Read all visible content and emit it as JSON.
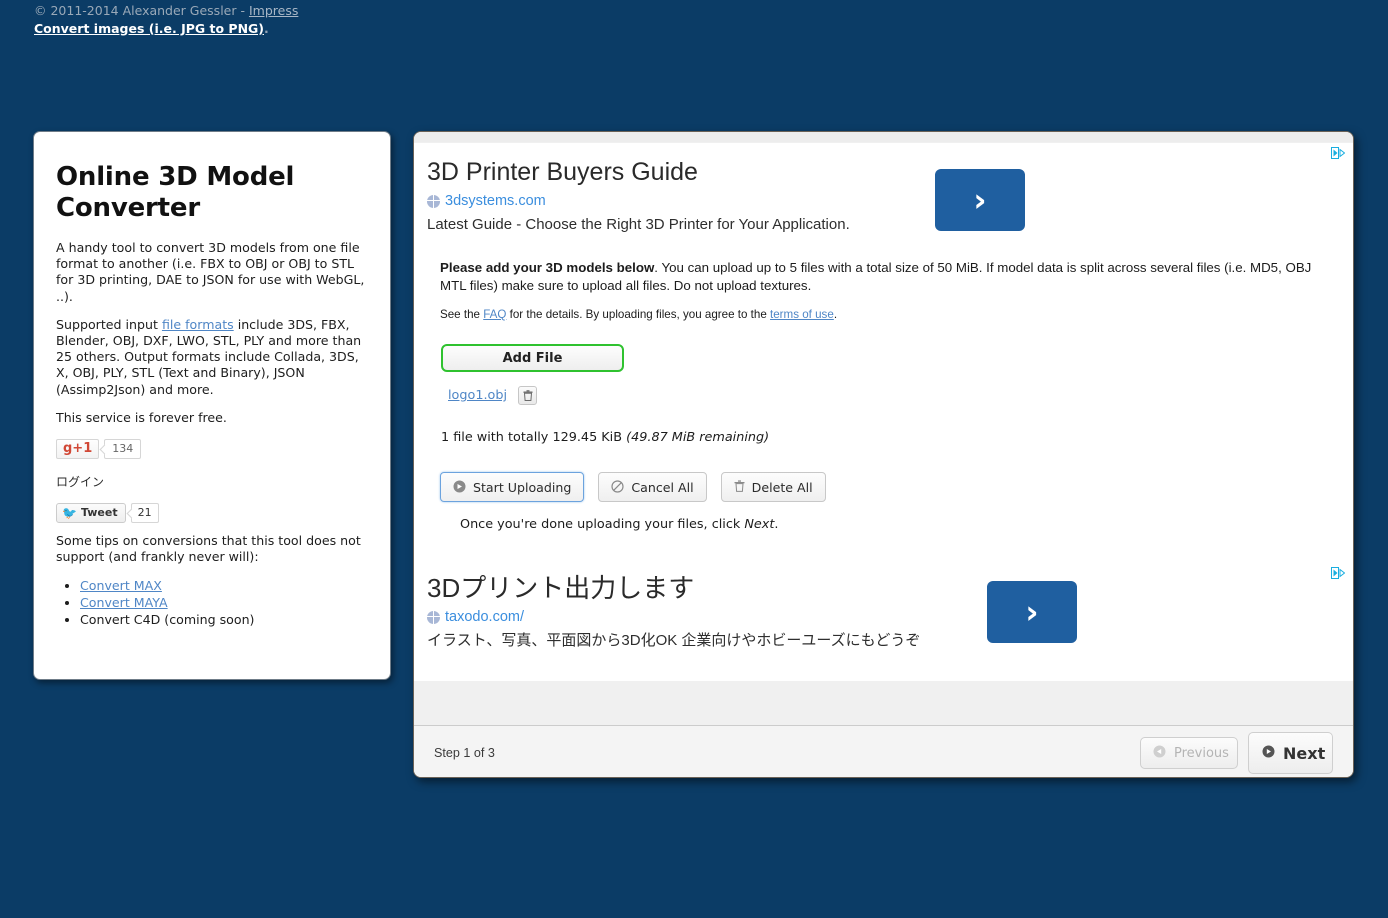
{
  "topbar": {
    "copyright": "© 2011-2014 Alexander Gessler - ",
    "impress_label": "Impress",
    "convert_link_label": "Convert images (i.e. JPG to PNG)",
    "convert_suffix": "."
  },
  "sidebar": {
    "title": "Online 3D Model Converter",
    "intro": "A handy tool to convert 3D models from one file format to another (i.e. FBX to OBJ or OBJ to STL for 3D printing, DAE to JSON for use with WebGL, ..).",
    "formats_prefix": "Supported input ",
    "formats_link_label": "file formats",
    "formats_suffix": " include 3DS, FBX, Blender, OBJ, DXF, LWO, STL, PLY and more than 25 others. Output formats include Collada, 3DS, X, OBJ, PLY, STL (Text and Binary), JSON (Assimp2Json) and more.",
    "free_note": "This service is forever free.",
    "gplus_label": "g+1",
    "gplus_count": "134",
    "login_label": "ログイン",
    "tweet_label": "Tweet",
    "tweet_count": "21",
    "tips_intro": "Some tips on conversions that this tool does not support (and frankly never will):",
    "tips": [
      {
        "label": "Convert MAX",
        "link": true
      },
      {
        "label": "Convert MAYA",
        "link": true
      },
      {
        "label": "Convert C4D (coming soon)",
        "link": false
      }
    ]
  },
  "ads": [
    {
      "title": "3D Printer Buyers Guide",
      "url": "3dsystems.com",
      "description": "Latest Guide - Choose the Right 3D Printer for Your Application.",
      "arrow": "›"
    },
    {
      "title": "3Dプリント出力します",
      "url": "taxodo.com/",
      "description": "イラスト、写真、平面図から3D化OK 企業向けやホビーユーズにもどうぞ",
      "arrow": "›"
    }
  ],
  "instructions": {
    "bold_lead": "Please add your 3D models below",
    "body": ". You can upload up to 5 files with a total size of 50 MiB. If model data is split across several files (i.e. MD5, OBJ MTL files) make sure to upload all files. Do not upload textures.",
    "faq_prefix": "See the ",
    "faq_link": "FAQ",
    "faq_middle": " for the details. By uploading files, you agree to the ",
    "terms_link": "terms of use",
    "faq_suffix": "."
  },
  "upload": {
    "add_file_label": "Add File",
    "files": [
      {
        "name": "logo1.obj",
        "delete_icon": "🗑"
      }
    ],
    "summary_main": "1 file with totally 129.45 KiB",
    "summary_note": "(49.87 MiB remaining)",
    "buttons": [
      {
        "label": "Start Uploading",
        "icon": "➤",
        "focused": true
      },
      {
        "label": "Cancel All",
        "icon": "⊘",
        "focused": false
      },
      {
        "label": "Delete All",
        "icon": "🗑",
        "focused": false
      }
    ],
    "done_prefix": "Once you're done uploading your files, click ",
    "done_emphasis": "Next",
    "done_suffix": "."
  },
  "footer": {
    "step_label": "Step 1 of 3",
    "previous_label": "Previous",
    "previous_icon": "◉",
    "next_label": "Next",
    "next_icon": "◉"
  },
  "colors": {
    "page_background": "#0b3c66",
    "accent_green": "#2fc22f",
    "ad_link_blue": "#3b8ede",
    "ad_button_blue": "#1f5fa0",
    "adchoices_blue": "#19aee0",
    "link_blue": "#4f86c6"
  }
}
